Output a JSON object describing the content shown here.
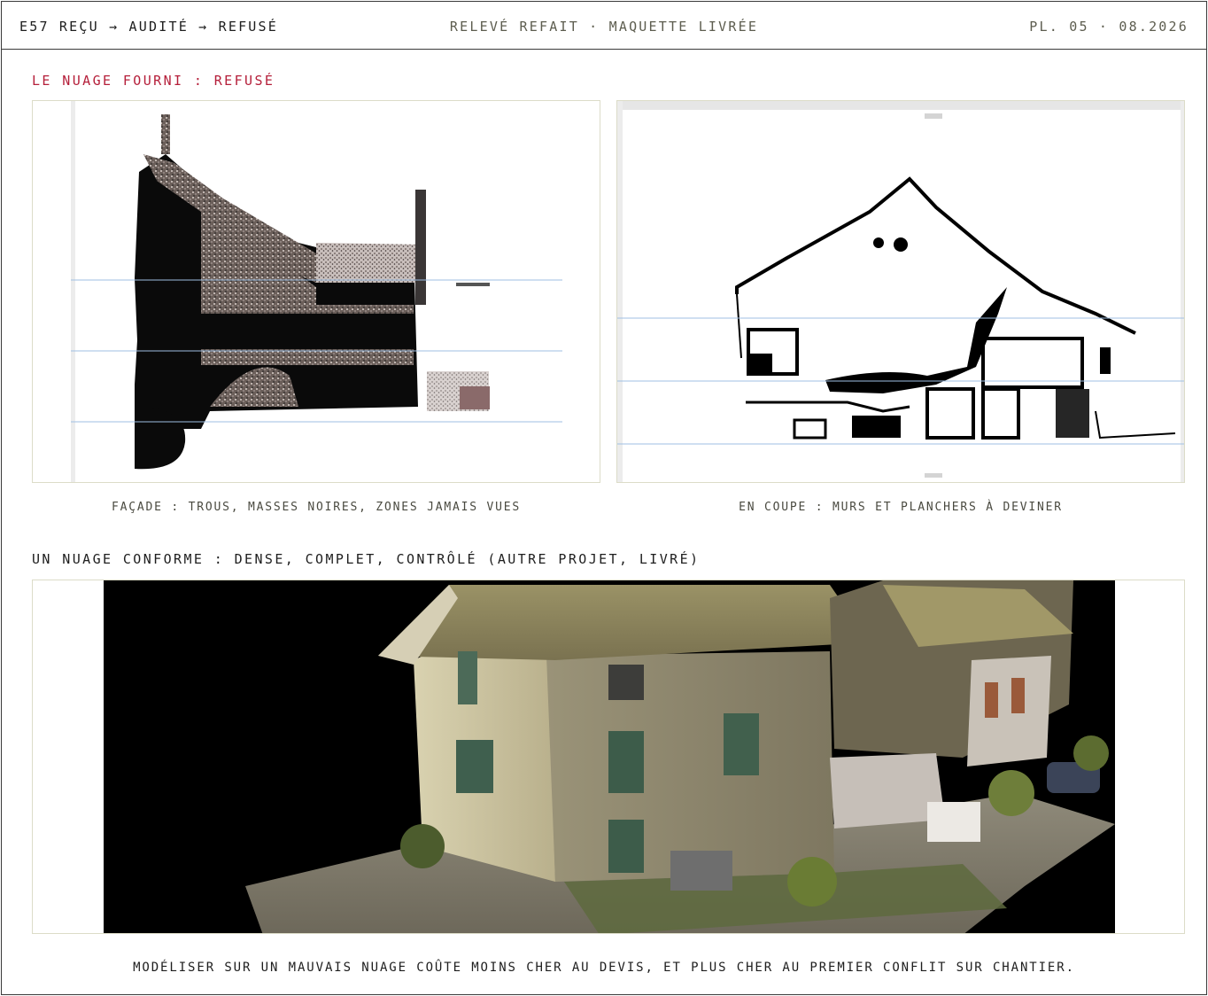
{
  "header": {
    "left": "E57 REÇU → AUDITÉ → REFUSÉ",
    "center": "RELEVÉ REFAIT · MAQUETTE LIVRÉE",
    "right": "PL. 05 · 08.2026"
  },
  "rejected": {
    "title": "LE NUAGE FOURNI : REFUSÉ",
    "left_caption": "FAÇADE : TROUS, MASSES NOIRES, ZONES JAMAIS VUES",
    "right_caption": "EN COUPE : MURS ET PLANCHERS À DEVINER"
  },
  "compliant": {
    "title": "UN NUAGE CONFORME : DENSE, COMPLET, CONTRÔLÉ (AUTRE PROJET, LIVRÉ)"
  },
  "footer": {
    "note": "MODÉLISER SUR UN MAUVAIS NUAGE COÛTE MOINS CHER AU DEVIS, ET PLUS CHER AU PREMIER CONFLIT SUR CHANTIER."
  },
  "colors": {
    "border": "#3a3a3a",
    "accent_red": "#b51f3a",
    "panel_border": "#dcdcc8",
    "guide_line": "#9fbfe3"
  }
}
